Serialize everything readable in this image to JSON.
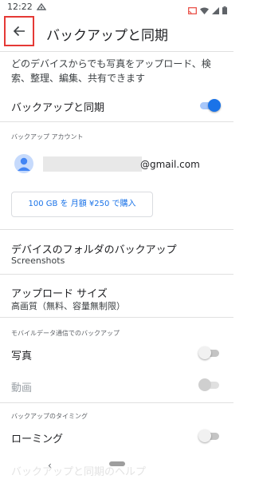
{
  "status_bar": {
    "time": "12:22",
    "icons": [
      "notification-icon",
      "cast-icon",
      "wifi-icon",
      "signal-icon",
      "battery-icon"
    ]
  },
  "app_bar": {
    "title": "バックアップと同期",
    "back_icon": "arrow-back-icon"
  },
  "description": "どのデバイスからでも写真をアップロード、検索、整理、編集、共有できます",
  "backup_sync": {
    "label": "バックアップと同期",
    "enabled": true
  },
  "account": {
    "section_label": "バックアップ アカウント",
    "email_suffix": "@gmail.com"
  },
  "storage_offer": {
    "label": "100 GB を 月額 ¥250 で購入"
  },
  "device_folders": {
    "title": "デバイスのフォルダのバックアップ",
    "subtitle": "Screenshots"
  },
  "upload_size": {
    "title": "アップロード サイズ",
    "subtitle": "高画質（無料、容量無制限）"
  },
  "mobile_data": {
    "section_label": "モバイルデータ通信でのバックアップ",
    "photos_label": "写真",
    "photos_enabled": false,
    "videos_label": "動画",
    "videos_enabled": false
  },
  "timing": {
    "section_label": "バックアップのタイミング",
    "roaming_label": "ローミング",
    "roaming_enabled": false
  },
  "bottom_faded_text": "バックアップと同期のヘルプ",
  "colors": {
    "accent": "#1a73e8",
    "highlight_border": "#e53935"
  }
}
